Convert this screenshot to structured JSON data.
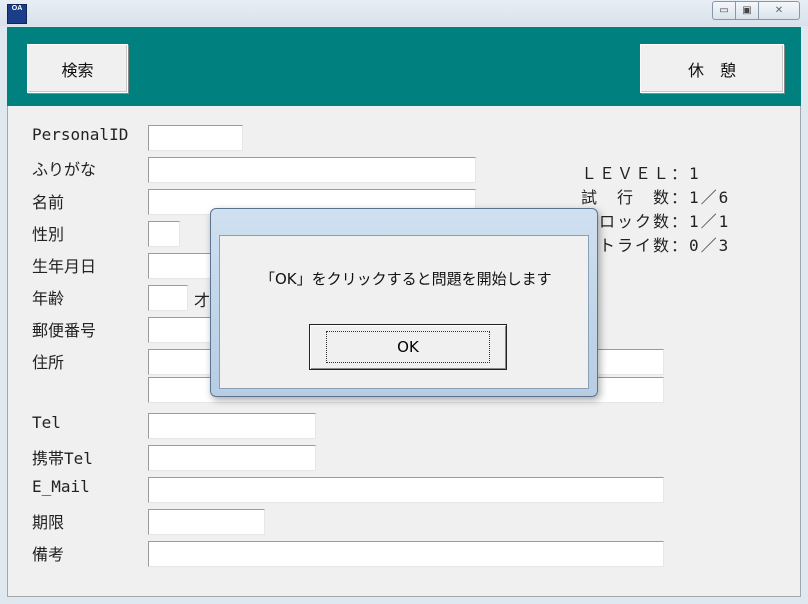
{
  "window": {
    "icon_label": "OA",
    "controls": {
      "minimize": "▭",
      "maximize": "▣",
      "close": "✕"
    }
  },
  "toolbar": {
    "search_label": "検索",
    "rest_label": "休　憩"
  },
  "form": {
    "personal_id": "PersonalID",
    "furigana": "ふりがな",
    "name": "名前",
    "gender": "性別",
    "birthdate": "生年月日",
    "age": "年齢",
    "age_unit": "才",
    "postal_code": "郵便番号",
    "address": "住所",
    "tel": "Tel",
    "mobile_tel": "携帯Tel",
    "email": "E_Mail",
    "deadline": "期限",
    "notes": "備考"
  },
  "status": {
    "level": "ＬＥＶＥＬ：1",
    "trials": "試　行　数：1／6",
    "blocks": "ブロック数：1／1",
    "retries": "リトライ数：0／3"
  },
  "dialog": {
    "message": "「OK」をクリックすると問題を開始します",
    "ok_label": "OK"
  }
}
